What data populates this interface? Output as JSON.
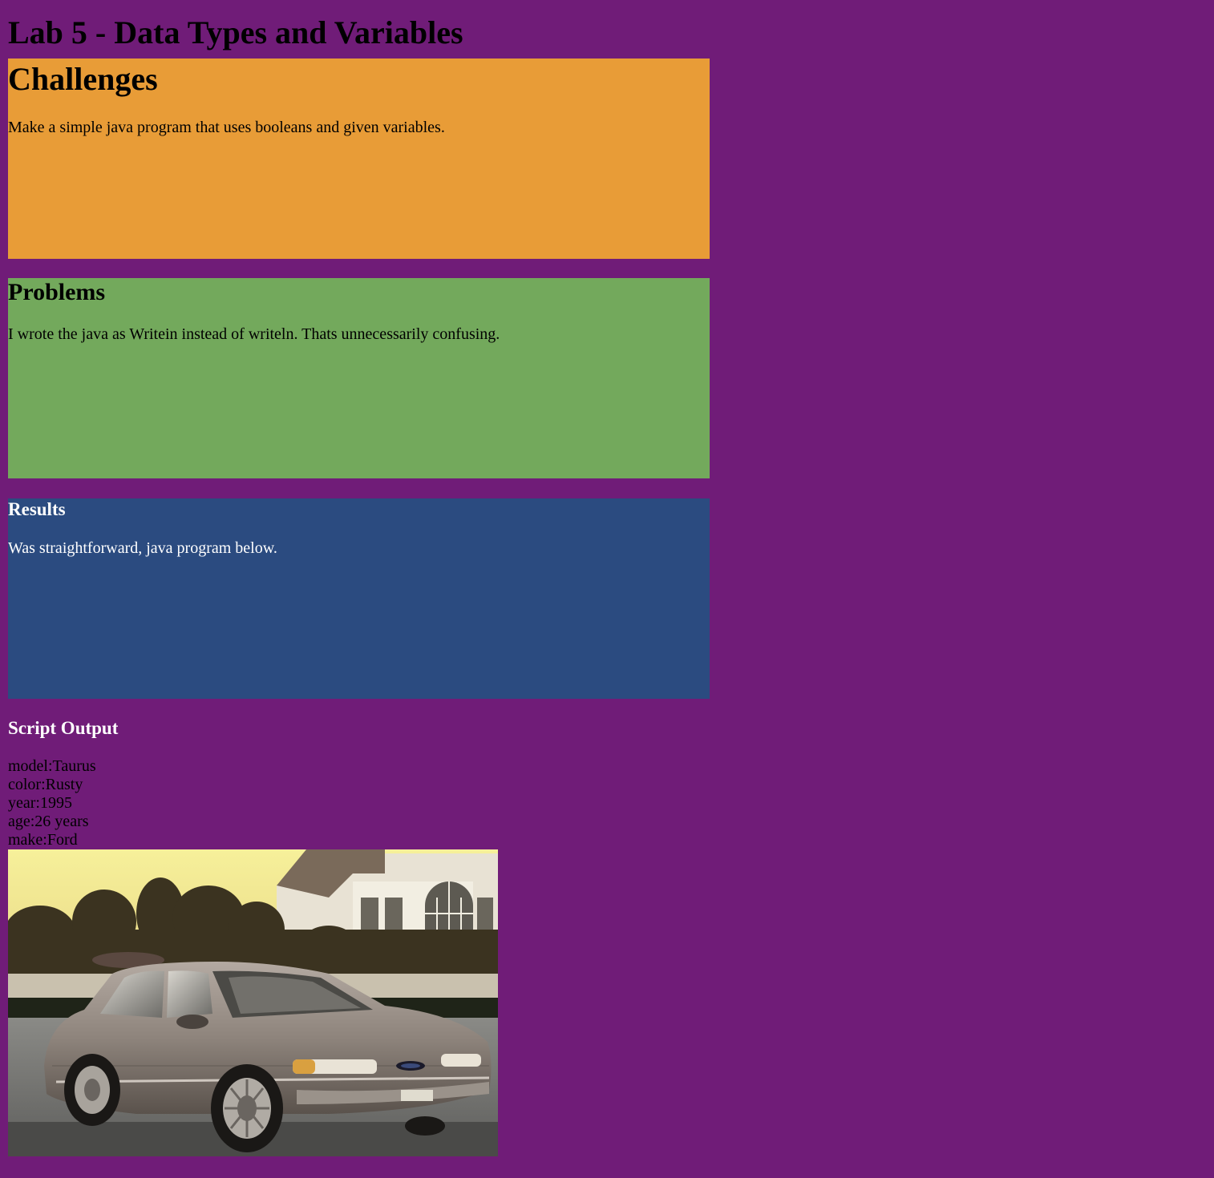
{
  "page": {
    "title": "Lab 5 - Data Types and Variables"
  },
  "challenges": {
    "heading": "Challenges",
    "text": "Make a simple java program that uses booleans and given variables."
  },
  "problems": {
    "heading": "Problems",
    "text": "I wrote the java as Writein instead of writeln. Thats unnecessarily confusing."
  },
  "results": {
    "heading": "Results",
    "text": "Was straightforward, java program below."
  },
  "script_output": {
    "heading": "Script Output",
    "lines": [
      "model:Taurus",
      "color:Rusty",
      "year:1995",
      "age:26 years",
      "make:Ford"
    ]
  },
  "colors": {
    "background": "#701c78",
    "challenges_bg": "#e89c37",
    "problems_bg": "#73a95c",
    "results_bg": "#2b4b80"
  }
}
